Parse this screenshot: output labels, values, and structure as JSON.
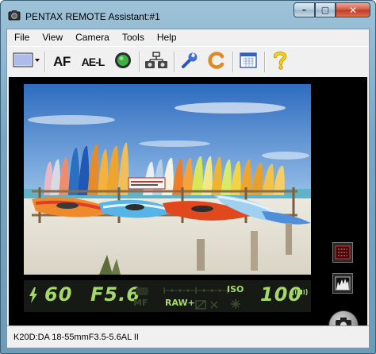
{
  "window": {
    "title": "PENTAX REMOTE Assistant:#1",
    "minimize_glyph": "–",
    "maximize_glyph": "▢",
    "close_glyph": "✕"
  },
  "menu": {
    "items": [
      {
        "label": "File"
      },
      {
        "label": "View"
      },
      {
        "label": "Camera"
      },
      {
        "label": "Tools"
      },
      {
        "label": "Help"
      }
    ]
  },
  "toolbar": {
    "af_label": "AF",
    "ael_label": "AE-L",
    "buttons": [
      {
        "icon": "capture-mode-dropdown-icon"
      },
      {
        "icon": "af-icon"
      },
      {
        "icon": "ae-lock-icon"
      },
      {
        "icon": "green-button-icon"
      },
      {
        "icon": "camera-network-icon"
      },
      {
        "icon": "wrench-icon"
      },
      {
        "icon": "reset-icon"
      },
      {
        "icon": "calendar-icon"
      },
      {
        "icon": "help-icon"
      }
    ]
  },
  "lcd": {
    "shutter_speed": "60",
    "aperture": "F5.6",
    "iso_label": "ISO",
    "iso_value": "100",
    "mf_label": "MF",
    "raw_label": "RAW+",
    "colors": {
      "active": "#a5d86b",
      "inactive": "#3a4a2e"
    }
  },
  "status": {
    "text": "K20D:DA 18-55mmF3.5-5.6AL II"
  },
  "colors": {
    "window_frame": "#7aa6c2",
    "close_button": "#c13a22",
    "viewer_background": "#000000"
  }
}
